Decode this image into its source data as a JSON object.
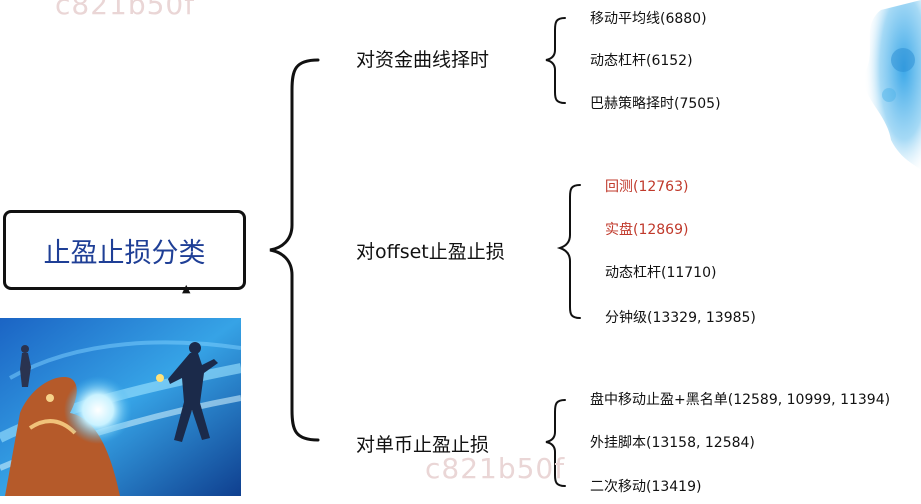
{
  "watermark_top": "c821b50f",
  "watermark_bottom": "c821b50f",
  "root": {
    "label": "止盈止损分类"
  },
  "branches": [
    {
      "label": "对资金曲线择时",
      "items": [
        {
          "label": "移动平均线(6880)",
          "highlight": false
        },
        {
          "label": "动态杠杆(6152)",
          "highlight": false
        },
        {
          "label": "巴赫策略择时(7505)",
          "highlight": false
        }
      ]
    },
    {
      "label": "对offset止盈止损",
      "items": [
        {
          "label": "回测(12763)",
          "highlight": true
        },
        {
          "label": "实盘(12869)",
          "highlight": true
        },
        {
          "label": "动态杠杆(11710)",
          "highlight": false
        },
        {
          "label": "分钟级(13329, 13985)",
          "highlight": false
        }
      ]
    },
    {
      "label": "对单币止盈止损",
      "items": [
        {
          "label": "盘中移动止盈+黑名单(12589, 10999, 11394)",
          "highlight": false
        },
        {
          "label": "外挂脚本(13158, 12584)",
          "highlight": false
        },
        {
          "label": "二次移动(13419)",
          "highlight": false
        }
      ]
    }
  ],
  "colors": {
    "root_text": "#1f3f96",
    "highlight": "#c0392b",
    "line": "#111111"
  },
  "icons": {
    "cursor": "mouse-cursor-icon",
    "art": "anime-scene-illustration",
    "corner": "blue-ink-splash"
  }
}
